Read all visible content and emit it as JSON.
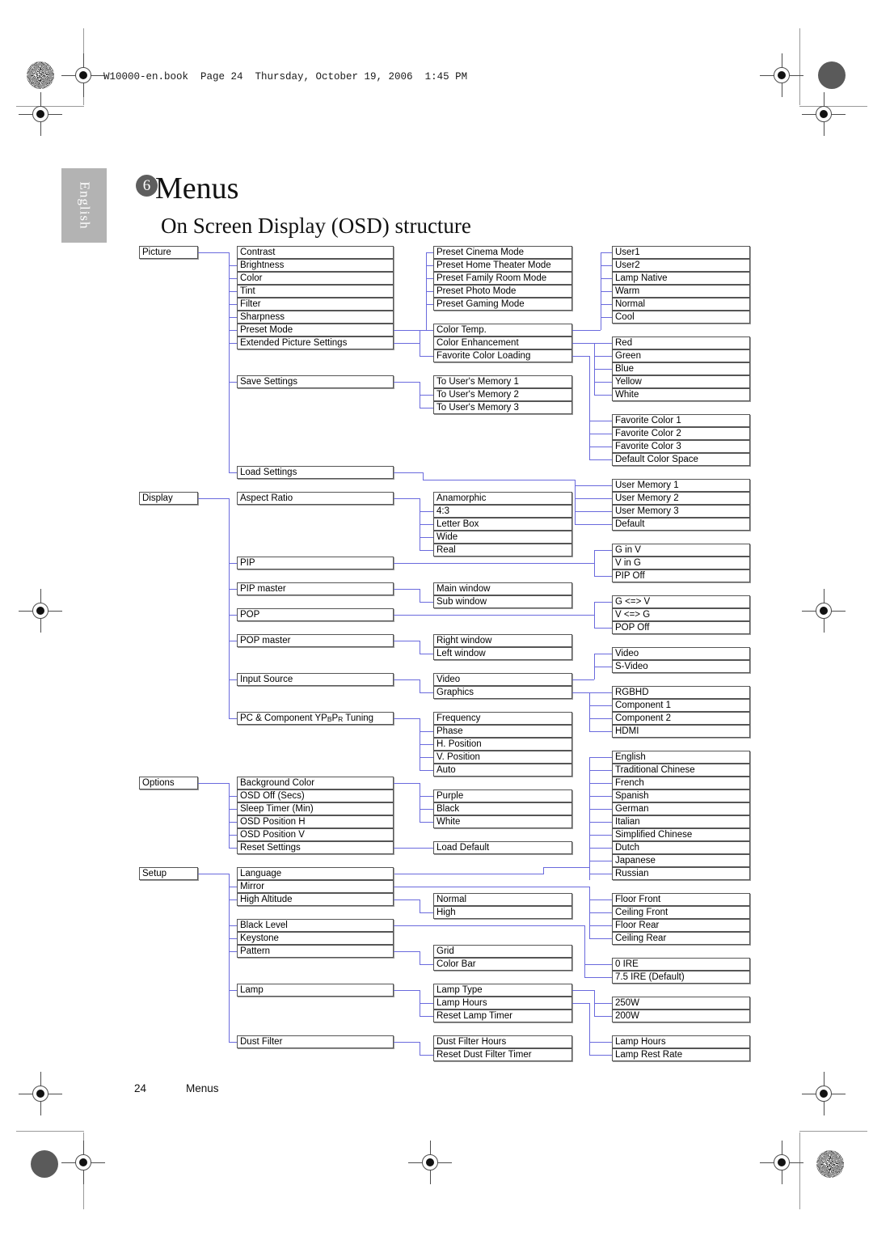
{
  "page": {
    "book_line": "W10000-en.book  Page 24  Thursday, October 19, 2006  1:45 PM",
    "language_tab": "English",
    "chapter_number": "6",
    "chapter_title": "Menus",
    "section_title": "On Screen Display (OSD) structure",
    "footer_page_number": "24",
    "footer_label": "Menus",
    "line_color": "#6a6add",
    "box_border_color": "#555555",
    "tab_bg_color": "#b3b3b3"
  },
  "menu": {
    "picture": {
      "root": "Picture",
      "items": [
        "Contrast",
        "Brightness",
        "Color",
        "Tint",
        "Filter",
        "Sharpness",
        "Preset Mode",
        "Extended Picture Settings"
      ],
      "save_settings": "Save Settings",
      "load_settings": "Load Settings",
      "preset_modes": [
        "Preset Cinema Mode",
        "Preset Home Theater Mode",
        "Preset Family Room Mode",
        "Preset Photo Mode",
        "Preset Gaming Mode"
      ],
      "extended": [
        "Color Temp.",
        "Color Enhancement",
        "Favorite Color Loading"
      ],
      "color_temp": [
        "User1",
        "User2",
        "Lamp Native",
        "Warm",
        "Normal",
        "Cool"
      ],
      "color_enhancement": [
        "Red",
        "Green",
        "Blue",
        "Yellow",
        "White"
      ],
      "favorite_color_loading": [
        "Favorite Color 1",
        "Favorite Color 2",
        "Favorite Color 3",
        "Default Color Space"
      ],
      "save_targets": [
        "To User's Memory 1",
        "To User's Memory 2",
        "To User's Memory 3"
      ],
      "load_targets": [
        "User Memory 1",
        "User Memory 2",
        "User Memory 3",
        "Default"
      ]
    },
    "display": {
      "root": "Display",
      "items": [
        "Aspect Ratio",
        "PIP",
        "PIP master",
        "POP",
        "POP master",
        "Input Source",
        "PC & Component YPBPR Tuning"
      ],
      "aspect_ratio": [
        "Anamorphic",
        "4:3",
        "Letter Box",
        "Wide",
        "Real"
      ],
      "pip": [
        "G in V",
        "V in G",
        "PIP Off"
      ],
      "pip_master": [
        "Main window",
        "Sub window"
      ],
      "pop": [
        "G <=> V",
        "V <=> G",
        "POP Off"
      ],
      "pop_master": [
        "Right window",
        "Left window"
      ],
      "input_source": [
        "Video",
        "Graphics"
      ],
      "input_video": [
        "Video",
        "S-Video"
      ],
      "input_graphics": [
        "RGBHD",
        "Component 1",
        "Component 2",
        "HDMI"
      ],
      "tuning": [
        "Frequency",
        "Phase",
        "H. Position",
        "V. Position",
        "Auto"
      ]
    },
    "options": {
      "root": "Options",
      "items": [
        "Background Color",
        "OSD Off (Secs)",
        "Sleep Timer (Min)",
        "OSD Position H",
        "OSD Position V",
        "Reset Settings"
      ],
      "background_color": [
        "Purple",
        "Black",
        "White"
      ],
      "reset_settings": [
        "Load Default"
      ]
    },
    "setup": {
      "root": "Setup",
      "items": [
        "Language",
        "Mirror",
        "High Altitude",
        "Black Level",
        "Keystone",
        "Pattern",
        "Lamp",
        "Dust Filter"
      ],
      "languages": [
        "English",
        "Traditional Chinese",
        "French",
        "Spanish",
        "German",
        "Italian",
        "Simplified Chinese",
        "Dutch",
        "Japanese",
        "Russian"
      ],
      "mirror": [
        "Floor Front",
        "Ceiling Front",
        "Floor Rear",
        "Ceiling Rear"
      ],
      "high_altitude": [
        "Normal",
        "High"
      ],
      "black_level": [
        "0 IRE",
        "7.5 IRE (Default)"
      ],
      "pattern": [
        "Grid",
        "Color Bar"
      ],
      "lamp": [
        "Lamp Type",
        "Lamp Hours",
        "Reset Lamp Timer"
      ],
      "lamp_type": [
        "250W",
        "200W"
      ],
      "dust_filter": [
        "Dust Filter Hours",
        "Reset Dust Filter Timer"
      ],
      "lamp_hours_detail": [
        "Lamp Hours",
        "Lamp Rest Rate"
      ]
    }
  }
}
